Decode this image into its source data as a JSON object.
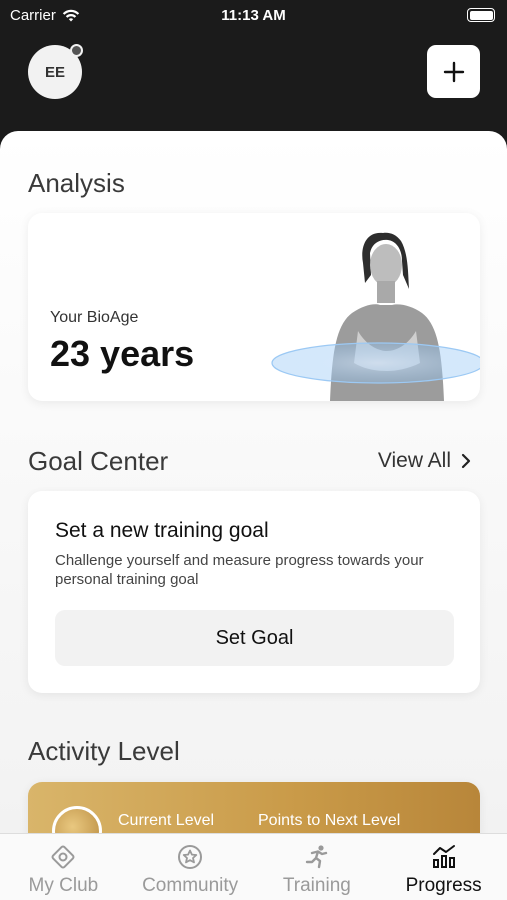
{
  "status_bar": {
    "carrier": "Carrier",
    "time": "11:13 AM"
  },
  "header": {
    "avatar_initials": "EE"
  },
  "analysis": {
    "title": "Analysis",
    "bioage_label": "Your BioAge",
    "bioage_value": "23 years"
  },
  "goal_center": {
    "title": "Goal Center",
    "view_all": "View All",
    "card_title": "Set a new training goal",
    "card_description": "Challenge yourself and measure progress towards your personal training goal",
    "button_label": "Set Goal"
  },
  "activity": {
    "title": "Activity Level",
    "current_level_label": "Current Level",
    "next_level_label": "Points to Next Level"
  },
  "tabs": [
    {
      "label": "My Club",
      "icon": "my-club-icon",
      "active": false
    },
    {
      "label": "Community",
      "icon": "community-icon",
      "active": false
    },
    {
      "label": "Training",
      "icon": "training-icon",
      "active": false
    },
    {
      "label": "Progress",
      "icon": "progress-icon",
      "active": true
    }
  ],
  "colors": {
    "header_bg": "#1b1b1b",
    "accent_gold": "#c99a48",
    "inactive_tab": "#9a9a9a"
  }
}
